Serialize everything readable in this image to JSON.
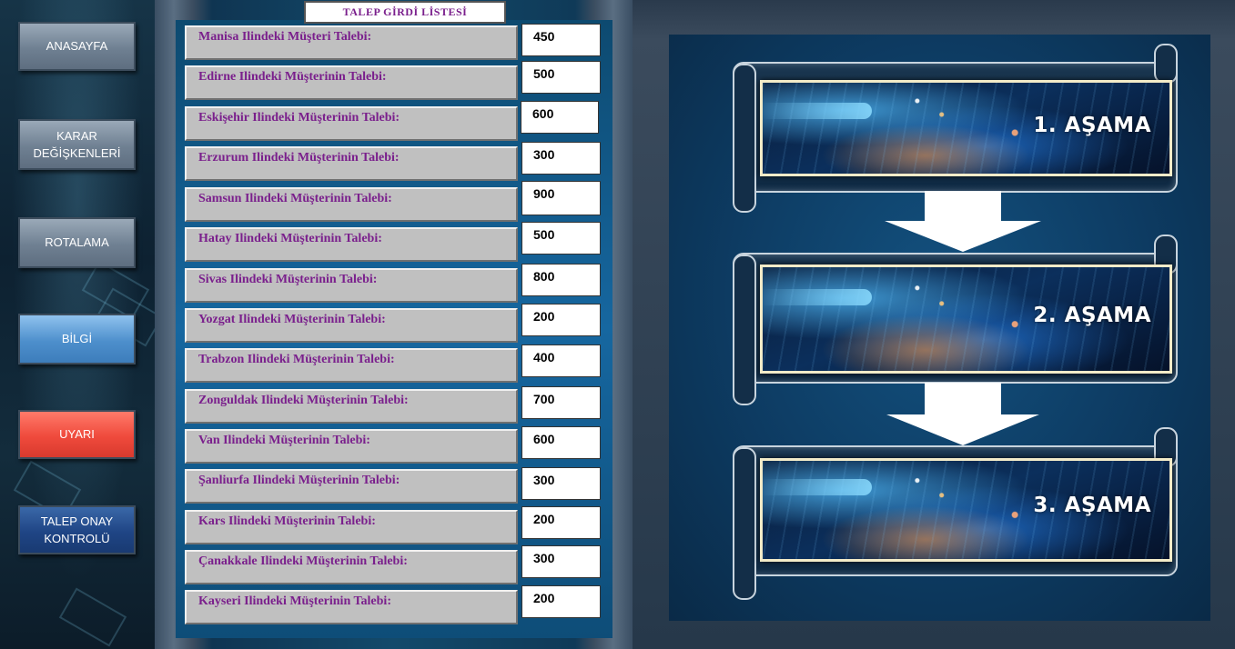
{
  "nav": {
    "anasayfa": "ANASAYFA",
    "karar_line1": "KARAR",
    "karar_line2": "DEĞİŞKENLERİ",
    "rotalama": "ROTALAMA",
    "bilgi": "BİLGİ",
    "uyari": "UYARI",
    "talep_line1": "TALEP ONAY",
    "talep_line2": "KONTROLÜ"
  },
  "list": {
    "title": "TALEP GİRDİ LİSTESİ",
    "rows": [
      {
        "label": "Manisa Ilindeki Müşteri Talebi:",
        "value": "450"
      },
      {
        "label": "Edirne Ilindeki Müşterinin Talebi:",
        "value": "500"
      },
      {
        "label": "Eskişehir Ilindeki Müşterinin Talebi:",
        "value": "600"
      },
      {
        "label": "Erzurum Ilindeki Müşterinin Talebi:",
        "value": "300"
      },
      {
        "label": "Samsun Ilindeki Müşterinin Talebi:",
        "value": "900"
      },
      {
        "label": "Hatay Ilindeki Müşterinin Talebi:",
        "value": "500"
      },
      {
        "label": "Sivas Ilindeki Müşterinin Talebi:",
        "value": "800"
      },
      {
        "label": "Yozgat Ilindeki Müşterinin Talebi:",
        "value": "200"
      },
      {
        "label": "Trabzon Ilindeki Müşterinin Talebi:",
        "value": "400"
      },
      {
        "label": "Zonguldak Ilindeki Müşterinin Talebi:",
        "value": "700"
      },
      {
        "label": "Van Ilindeki Müşterinin Talebi:",
        "value": "600"
      },
      {
        "label": "Şanliurfa Ilindeki Müşterinin Talebi:",
        "value": "300"
      },
      {
        "label": "Kars Ilindeki Müşterinin Talebi:",
        "value": "200"
      },
      {
        "label": "Çanakkale Ilindeki Müşterinin Talebi:",
        "value": "300"
      },
      {
        "label": "Kayseri Ilindeki Müşterinin Talebi:",
        "value": "200"
      }
    ]
  },
  "stages": {
    "s1": "1. AŞAMA",
    "s2": "2. AŞAMA",
    "s3": "3. AŞAMA"
  },
  "colors": {
    "label_text": "#7a1f8c",
    "nav_red": "#ef4a3c",
    "nav_blue": "#4d8fcc",
    "nav_navy": "#1f4585"
  }
}
